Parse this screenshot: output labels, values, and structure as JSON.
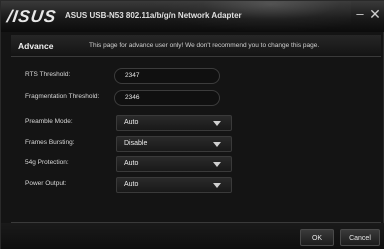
{
  "window": {
    "logo": "/ISUS",
    "title": "ASUS USB-N53 802.11a/b/g/n Network Adapter",
    "minimize": "–",
    "close": "✕"
  },
  "header": {
    "section": "Advance",
    "note": "This page for advance user only! We don't recommend you to change this page."
  },
  "fields": {
    "rts_label": "RTS Threshold:",
    "rts_value": "2347",
    "frag_label": "Fragmentation Threshold:",
    "frag_value": "2346",
    "preamble_label": "Preamble Mode:",
    "preamble_value": "Auto",
    "bursting_label": "Frames Bursting:",
    "bursting_value": "Disable",
    "g54_label": "54g Protection:",
    "g54_value": "Auto",
    "power_label": "Power Output:",
    "power_value": "Auto"
  },
  "buttons": {
    "ok": "OK",
    "cancel": "Cancel"
  }
}
